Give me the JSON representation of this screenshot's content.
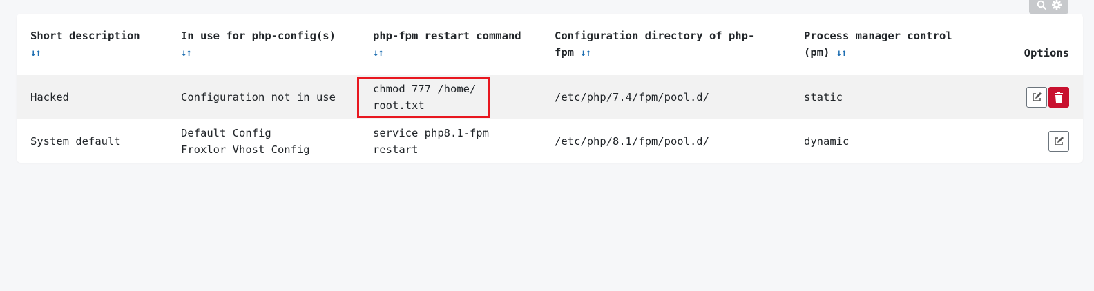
{
  "toolbar": {
    "search_icon": "search-icon",
    "settings_icon": "gear-icon"
  },
  "table": {
    "headers": [
      {
        "label": "Short description",
        "sort_icon": "↓↑"
      },
      {
        "label": "In use for php-config(s)",
        "sort_icon": "↓↑"
      },
      {
        "label": "php-fpm restart command",
        "sort_icon": "↓↑"
      },
      {
        "label": "Configuration directory of php-fpm",
        "sort_icon": "↓↑"
      },
      {
        "label": "Process manager control (pm)",
        "sort_icon": "↓↑"
      },
      {
        "label": "Options"
      }
    ],
    "rows": [
      {
        "description": "Hacked",
        "in_use": [
          "Configuration not in use"
        ],
        "restart_command": "chmod 777 /home/ root.txt",
        "config_dir": "/etc/php/7.4/fpm/pool.d/",
        "pm": "static",
        "actions": [
          "edit",
          "delete"
        ]
      },
      {
        "description": "System default",
        "in_use": [
          "Default Config",
          "Froxlor Vhost Config"
        ],
        "restart_command": "service php8.1-fpm restart",
        "config_dir": "/etc/php/8.1/fpm/pool.d/",
        "pm": "dynamic",
        "actions": [
          "edit"
        ]
      }
    ]
  },
  "colors": {
    "background": "#f6f7f9",
    "sort_icon": "#1f6fb2",
    "highlight_box": "#e8171f",
    "delete_button": "#c8102e",
    "row_highlight": "#f2f2f2"
  }
}
